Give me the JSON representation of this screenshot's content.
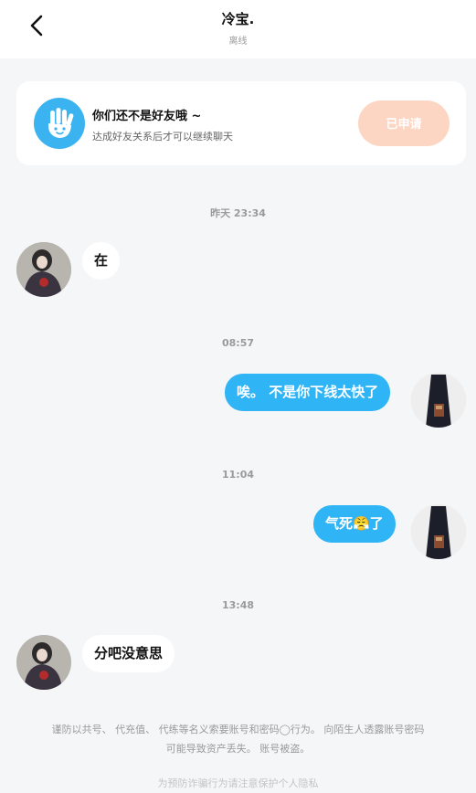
{
  "header": {
    "title": "冷宝.",
    "status": "离线"
  },
  "friend_card": {
    "title": "你们还不是好友哦 ~",
    "subtitle": "达成好友关系后才可以继续聊天",
    "button_label": "已申请"
  },
  "messages": [
    {
      "time": "昨天  23:34",
      "direction": "in",
      "text": "在"
    },
    {
      "time": "08:57",
      "direction": "out",
      "text": "唉。 不是你下线太快了"
    },
    {
      "time": "11:04",
      "direction": "out",
      "text": "气死😤了"
    },
    {
      "time": "13:48",
      "direction": "in",
      "text": "分吧没意思"
    }
  ],
  "notice": {
    "line1": "谨防以共号、 代充值、 代练等名义索要账号和密码◯行为。 向陌生人透露账号密码",
    "line2": "可能导致资产丢失。 账号被盗。",
    "line3": "为预防诈骗行为请注意保护个人隐私"
  },
  "colors": {
    "accent": "#2fb4f5",
    "button_applied": "#fcd5c3"
  }
}
